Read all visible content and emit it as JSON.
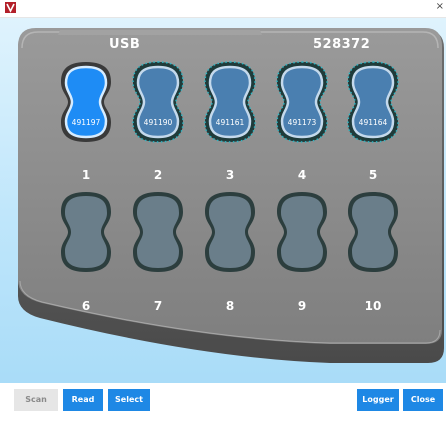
{
  "window": {
    "app_icon": "app-logo-icon",
    "close_label": "×"
  },
  "device": {
    "port_label": "USB",
    "device_serial": "528372"
  },
  "slots": [
    {
      "number": "1",
      "serial": "491197",
      "state": "selected"
    },
    {
      "number": "2",
      "serial": "491190",
      "state": "loaded"
    },
    {
      "number": "3",
      "serial": "491161",
      "state": "loaded"
    },
    {
      "number": "4",
      "serial": "491173",
      "state": "loaded"
    },
    {
      "number": "5",
      "serial": "491164",
      "state": "loaded"
    },
    {
      "number": "6",
      "serial": "",
      "state": "empty"
    },
    {
      "number": "7",
      "serial": "",
      "state": "empty"
    },
    {
      "number": "8",
      "serial": "",
      "state": "empty"
    },
    {
      "number": "9",
      "serial": "",
      "state": "empty"
    },
    {
      "number": "10",
      "serial": "",
      "state": "empty"
    }
  ],
  "toolbar": {
    "scan_label": "Scan",
    "read_label": "Read",
    "select_all_label": "Select All",
    "logger_list_label": "Logger List",
    "close_label": "Close"
  },
  "colors": {
    "accent": "#1e88e5",
    "selected_slot": "#1e8cf5",
    "loaded_slot": "#4a7fb0",
    "empty_slot": "#6a7e8a",
    "device_body": "#8c8c8c"
  }
}
